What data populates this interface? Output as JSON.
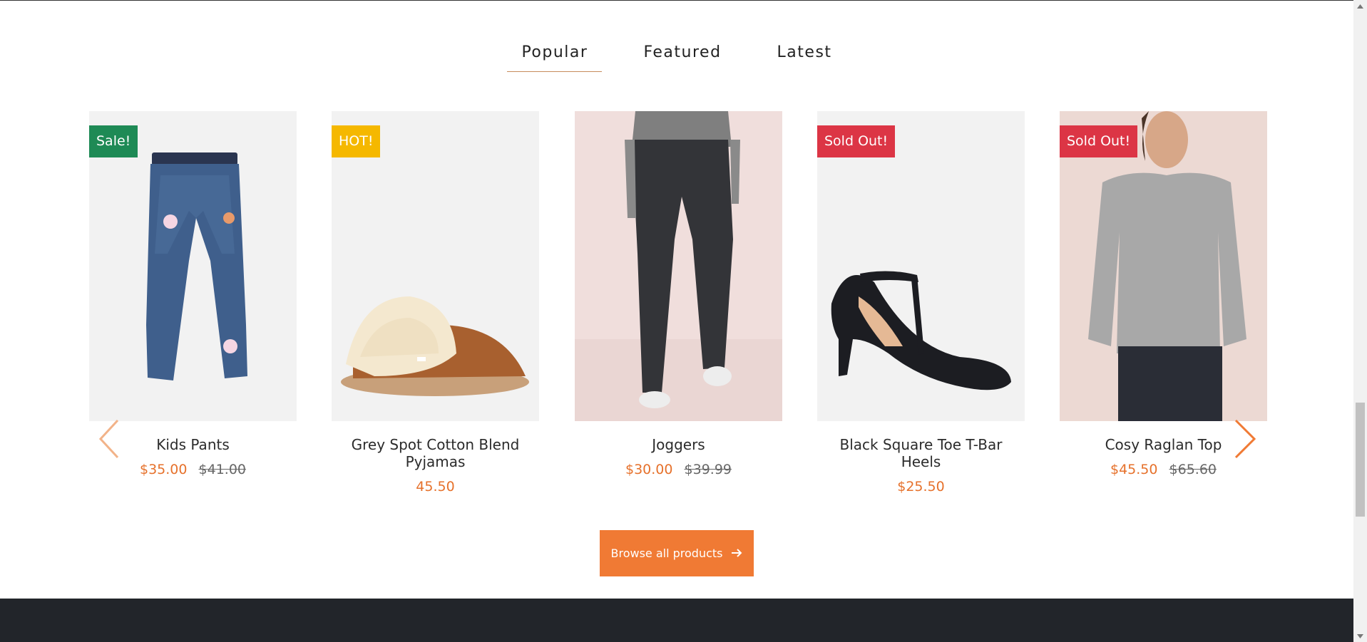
{
  "tabs": [
    {
      "label": "Popular",
      "active": true
    },
    {
      "label": "Featured",
      "active": false
    },
    {
      "label": "Latest",
      "active": false
    }
  ],
  "products": [
    {
      "name": "Kids Pants",
      "price": "$35.00",
      "old_price": "$41.00",
      "badge": "Sale!",
      "badge_color": "#1e8a55",
      "image": "kids-jeans-illustration"
    },
    {
      "name": "Grey Spot Cotton Blend Pyjamas",
      "price": "45.50",
      "old_price": "",
      "badge": "HOT!",
      "badge_color": "#f5b800",
      "image": "slipper-illustration"
    },
    {
      "name": "Joggers",
      "price": "$30.00",
      "old_price": "$39.99",
      "badge": "",
      "badge_color": "",
      "image": "joggers-illustration"
    },
    {
      "name": "Black Square Toe T-Bar Heels",
      "price": "$25.50",
      "old_price": "",
      "badge": "Sold Out!",
      "badge_color": "#dc3545",
      "image": "heels-illustration"
    },
    {
      "name": "Cosy Raglan Top",
      "price": "$45.50",
      "old_price": "$65.60",
      "badge": "Sold Out!",
      "badge_color": "#dc3545",
      "image": "sweater-illustration"
    }
  ],
  "browse_button": {
    "label": "Browse all products",
    "icon": "arrow-right-icon"
  },
  "colors": {
    "accent": "#f07a34",
    "price": "#e6712b",
    "footer": "#22252a"
  }
}
